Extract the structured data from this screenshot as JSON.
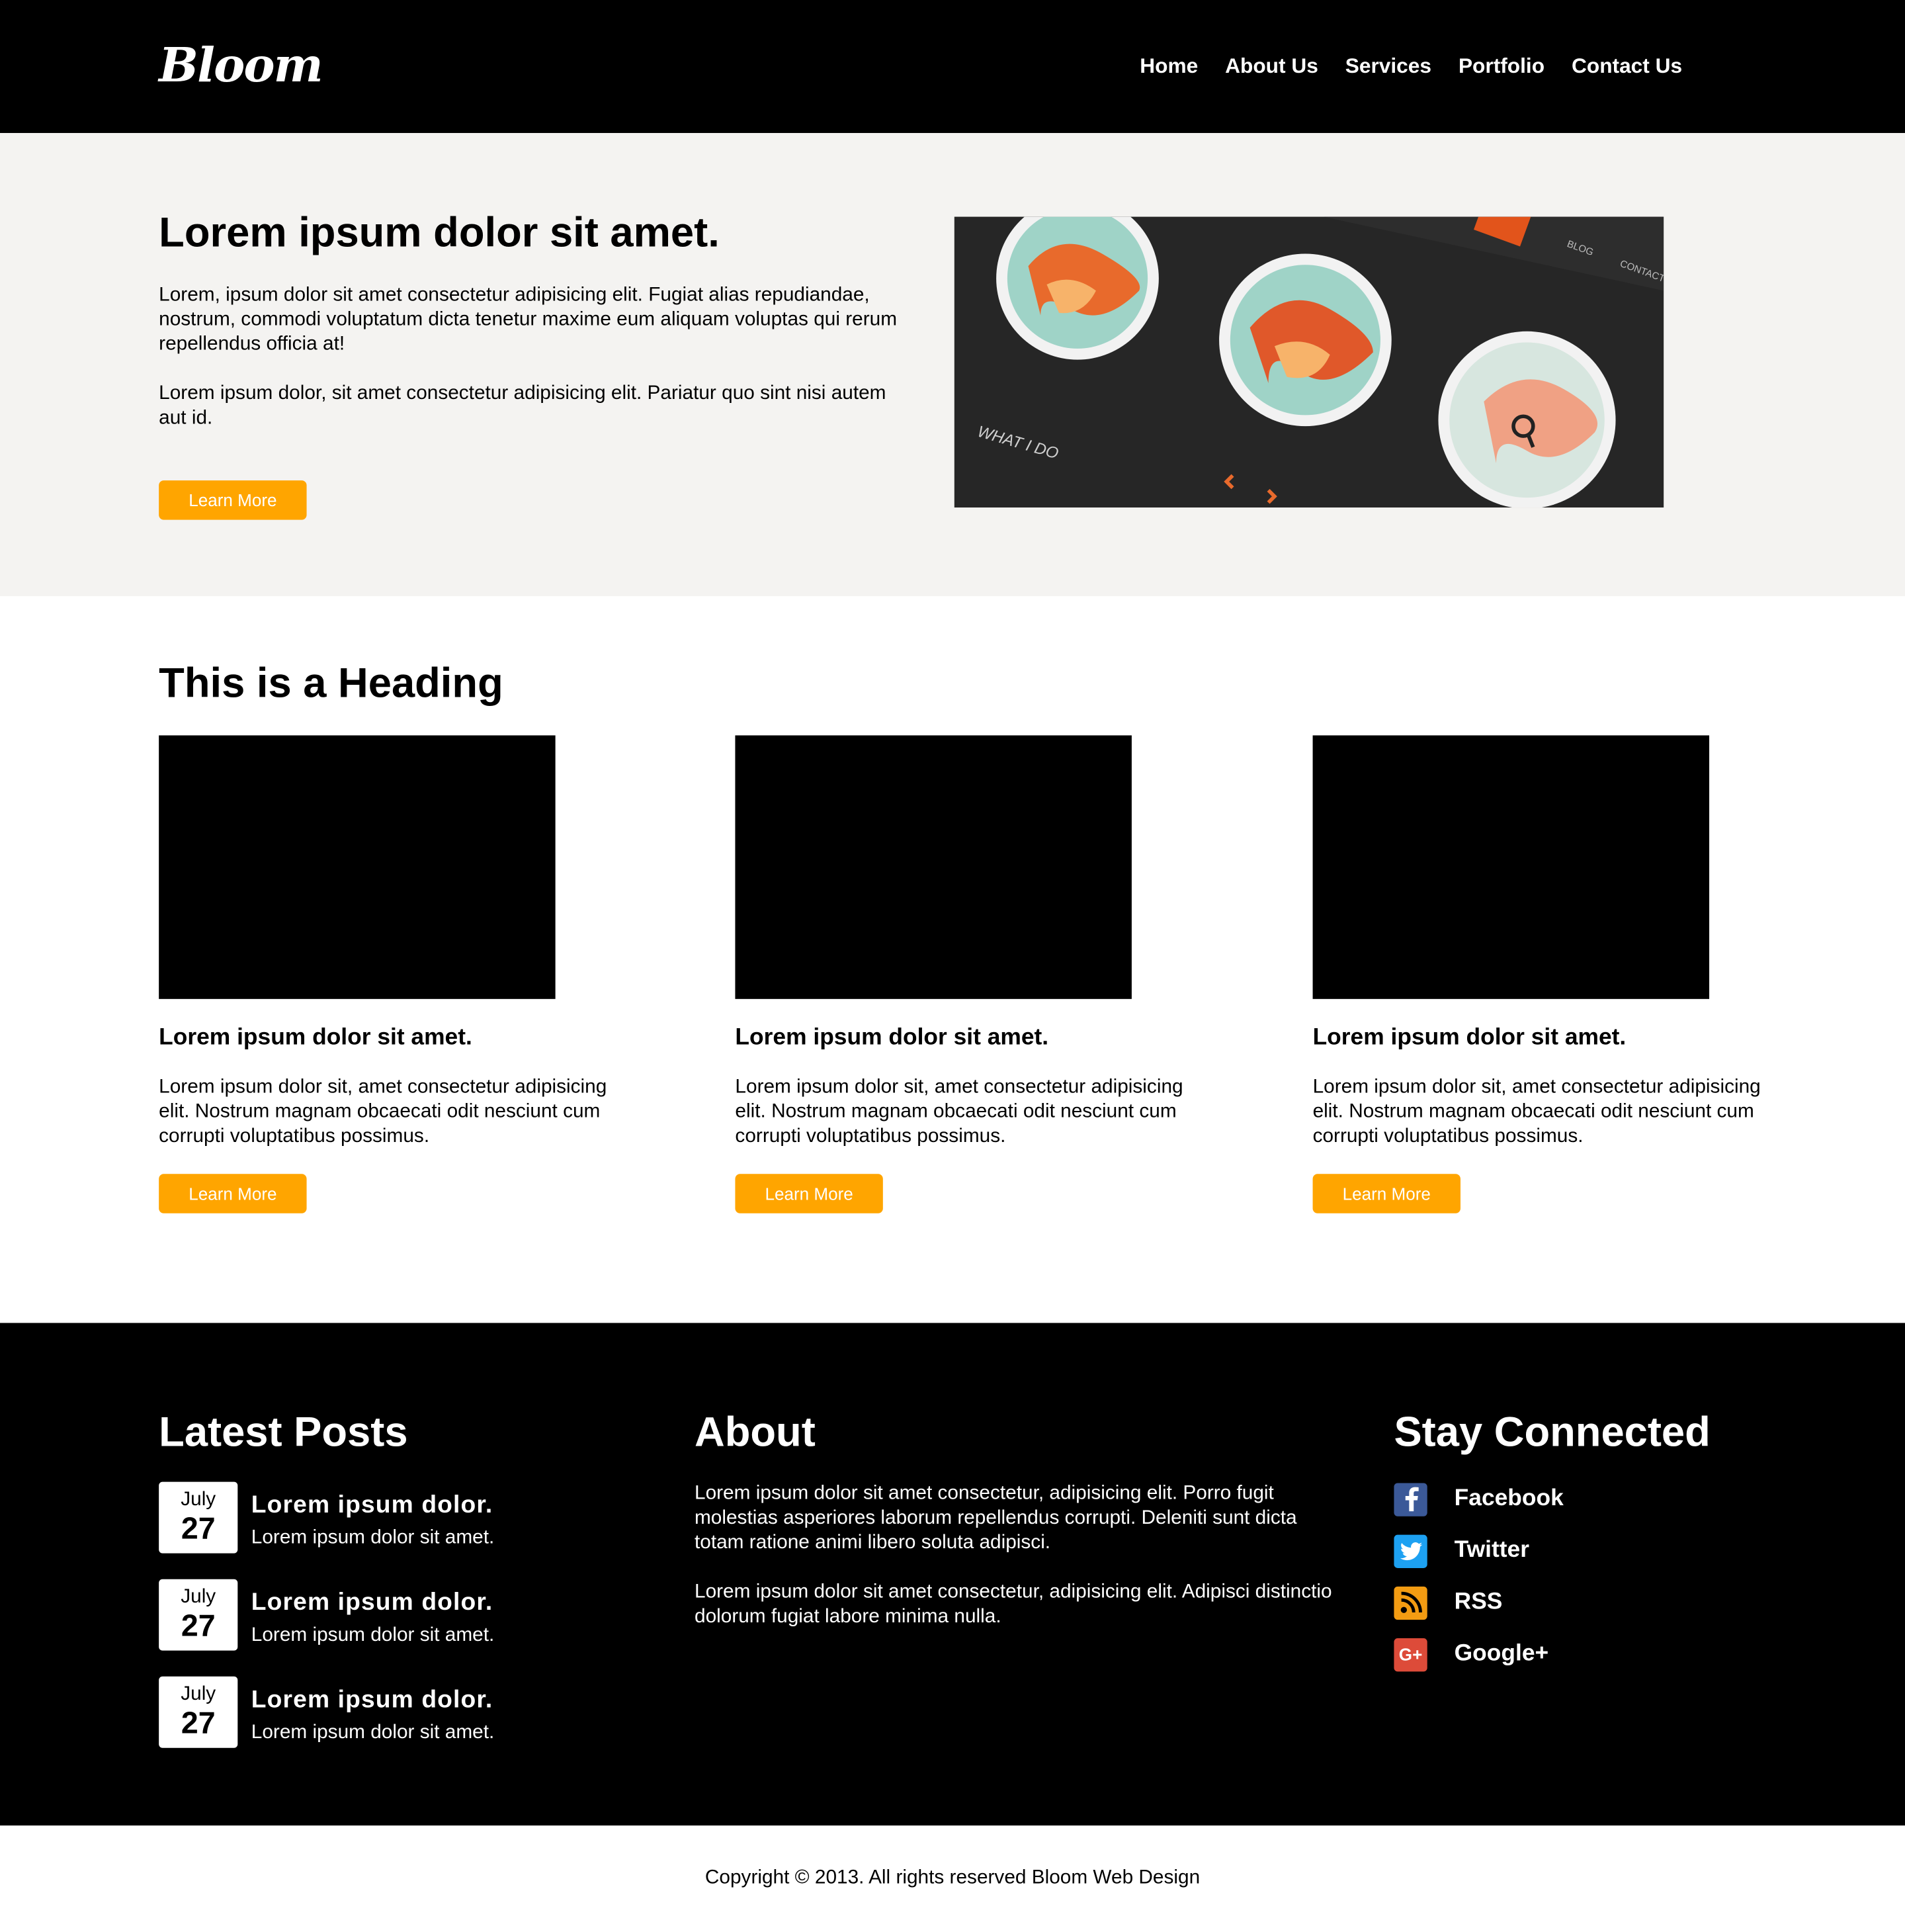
{
  "header": {
    "logo": "Bloom",
    "nav": [
      "Home",
      "About Us",
      "Services",
      "Portfolio",
      "Contact Us"
    ]
  },
  "hero": {
    "title": "Lorem ipsum dolor sit amet.",
    "paragraphs": [
      "Lorem, ipsum dolor sit amet consectetur adipisicing elit. Fugiat alias repudiandae, nostrum, commodi voluptatum dicta tenetur maxime eum aliquam voluptas qui rerum repellendus officia at!",
      "Lorem ipsum dolor, sit amet consectetur adipisicing elit. Pariatur quo sint nisi autem aut id."
    ],
    "button": "Learn More",
    "image_labels": {
      "what_i_do": "WHAT I DO",
      "blog": "BLOG",
      "contact": "CONTACT"
    }
  },
  "content": {
    "heading": "This is a Heading",
    "cards": [
      {
        "title": "Lorem ipsum dolor sit amet.",
        "text": "Lorem ipsum dolor sit, amet consectetur adipisicing elit. Nostrum magnam obcaecati odit nesciunt cum corrupti voluptatibus possimus.",
        "button": "Learn More"
      },
      {
        "title": "Lorem ipsum dolor sit amet.",
        "text": "Lorem ipsum dolor sit, amet consectetur adipisicing elit. Nostrum magnam obcaecati odit nesciunt cum corrupti voluptatibus possimus.",
        "button": "Learn More"
      },
      {
        "title": "Lorem ipsum dolor sit amet.",
        "text": "Lorem ipsum dolor sit, amet consectetur adipisicing elit. Nostrum magnam obcaecati odit nesciunt cum corrupti voluptatibus possimus.",
        "button": "Learn More"
      }
    ]
  },
  "footer": {
    "latest_posts": {
      "heading": "Latest Posts",
      "posts": [
        {
          "month": "July",
          "day": "27",
          "title": "Lorem ipsum dolor.",
          "subtitle": "Lorem ipsum dolor sit amet."
        },
        {
          "month": "July",
          "day": "27",
          "title": "Lorem ipsum dolor.",
          "subtitle": "Lorem ipsum dolor sit amet."
        },
        {
          "month": "July",
          "day": "27",
          "title": "Lorem ipsum dolor.",
          "subtitle": "Lorem ipsum dolor sit amet."
        }
      ]
    },
    "about": {
      "heading": "About",
      "paragraphs": [
        "Lorem ipsum dolor sit amet consectetur, adipisicing elit. Porro fugit molestias asperiores laborum repellendus corrupti. Deleniti sunt dicta totam ratione animi libero soluta adipisci.",
        "Lorem ipsum dolor sit amet consectetur, adipisicing elit. Adipisci distinctio dolorum fugiat labore minima nulla."
      ]
    },
    "stay_connected": {
      "heading": "Stay Connected",
      "links": [
        {
          "label": "Facebook",
          "icon": "facebook-icon",
          "color": "#3b5998",
          "glyph": "f"
        },
        {
          "label": "Twitter",
          "icon": "twitter-icon",
          "color": "#1da1f2",
          "glyph": "t"
        },
        {
          "label": "RSS",
          "icon": "rss-icon",
          "color": "#f39c12",
          "glyph": ""
        },
        {
          "label": "Google+",
          "icon": "google-plus-icon",
          "color": "#dd4b39",
          "glyph": "G+"
        }
      ]
    }
  },
  "copyright": "Copyright © 2013. All rights reserved Bloom Web Design",
  "colors": {
    "accent": "#ffa500",
    "header_bg": "#000000",
    "hero_bg": "#f4f3f1",
    "footer_bg": "#000000"
  }
}
